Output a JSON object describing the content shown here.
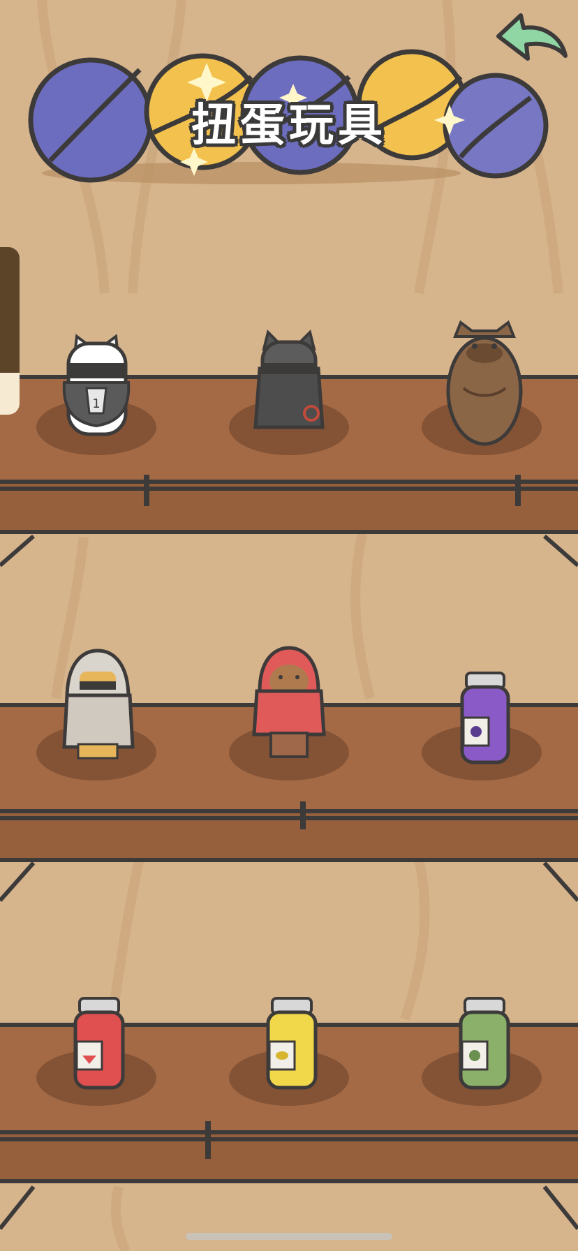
{
  "header": {
    "title": "扭蛋玩具",
    "back_icon": "back-arrow-icon"
  },
  "side_tab": {
    "icon": "drawer-tab"
  },
  "shelves": [
    {
      "row": 1,
      "items": [
        "panda-ninja-figure",
        "black-cat-cloak-figure",
        "brown-bear-figure"
      ]
    },
    {
      "row": 2,
      "items": [
        "hooded-ninja-figure",
        "red-hood-otter-figure",
        "purple-jam-jar"
      ]
    },
    {
      "row": 3,
      "items": [
        "red-jam-jar",
        "yellow-jam-jar",
        "green-jam-jar"
      ]
    }
  ],
  "colors": {
    "wall": "#d6b48c",
    "shelf": "#a36a45",
    "outline": "#3d3a3a",
    "capsule_blue": "#6d6dbf",
    "capsule_yellow": "#f3c24e",
    "back_arrow": "#8fd6a4"
  }
}
